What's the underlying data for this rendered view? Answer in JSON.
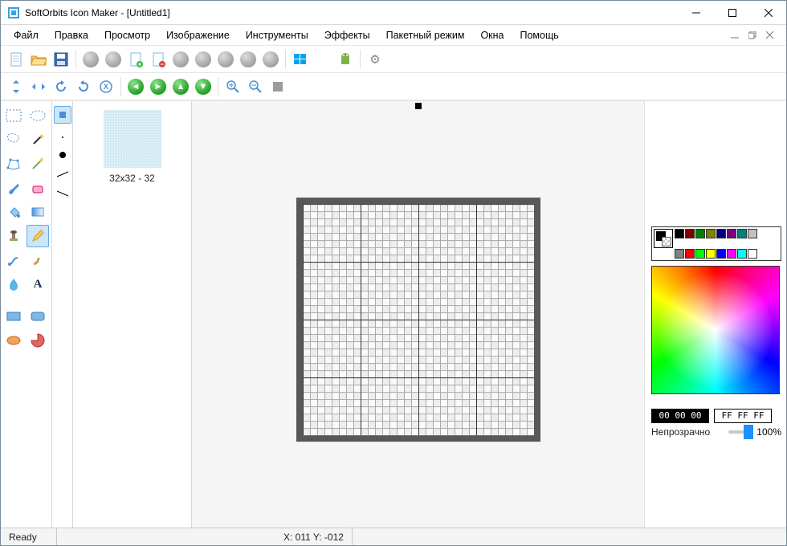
{
  "title": "SoftOrbits Icon Maker - [Untitled1]",
  "menu": {
    "file": "Файл",
    "edit": "Правка",
    "view": "Просмотр",
    "image": "Изображение",
    "tools": "Инструменты",
    "effects": "Эффекты",
    "batch": "Пакетный режим",
    "windows": "Окна",
    "help": "Помощь"
  },
  "pages": {
    "current_label": "32x32 - 32"
  },
  "colors": {
    "row1": [
      "#000000",
      "#800000",
      "#008000",
      "#808000",
      "#000080",
      "#800080",
      "#008080",
      "#c0c0c0"
    ],
    "row2": [
      "#808080",
      "#ff0000",
      "#00ff00",
      "#ffff00",
      "#0000ff",
      "#ff00ff",
      "#00ffff",
      "#ffffff"
    ],
    "fg_hex": "00 00 00",
    "bg_hex": "FF FF FF"
  },
  "opacity": {
    "label": "Непрозрачно",
    "value": "100%"
  },
  "status": {
    "ready": "Ready",
    "coords": "X: 011 Y: -012"
  }
}
